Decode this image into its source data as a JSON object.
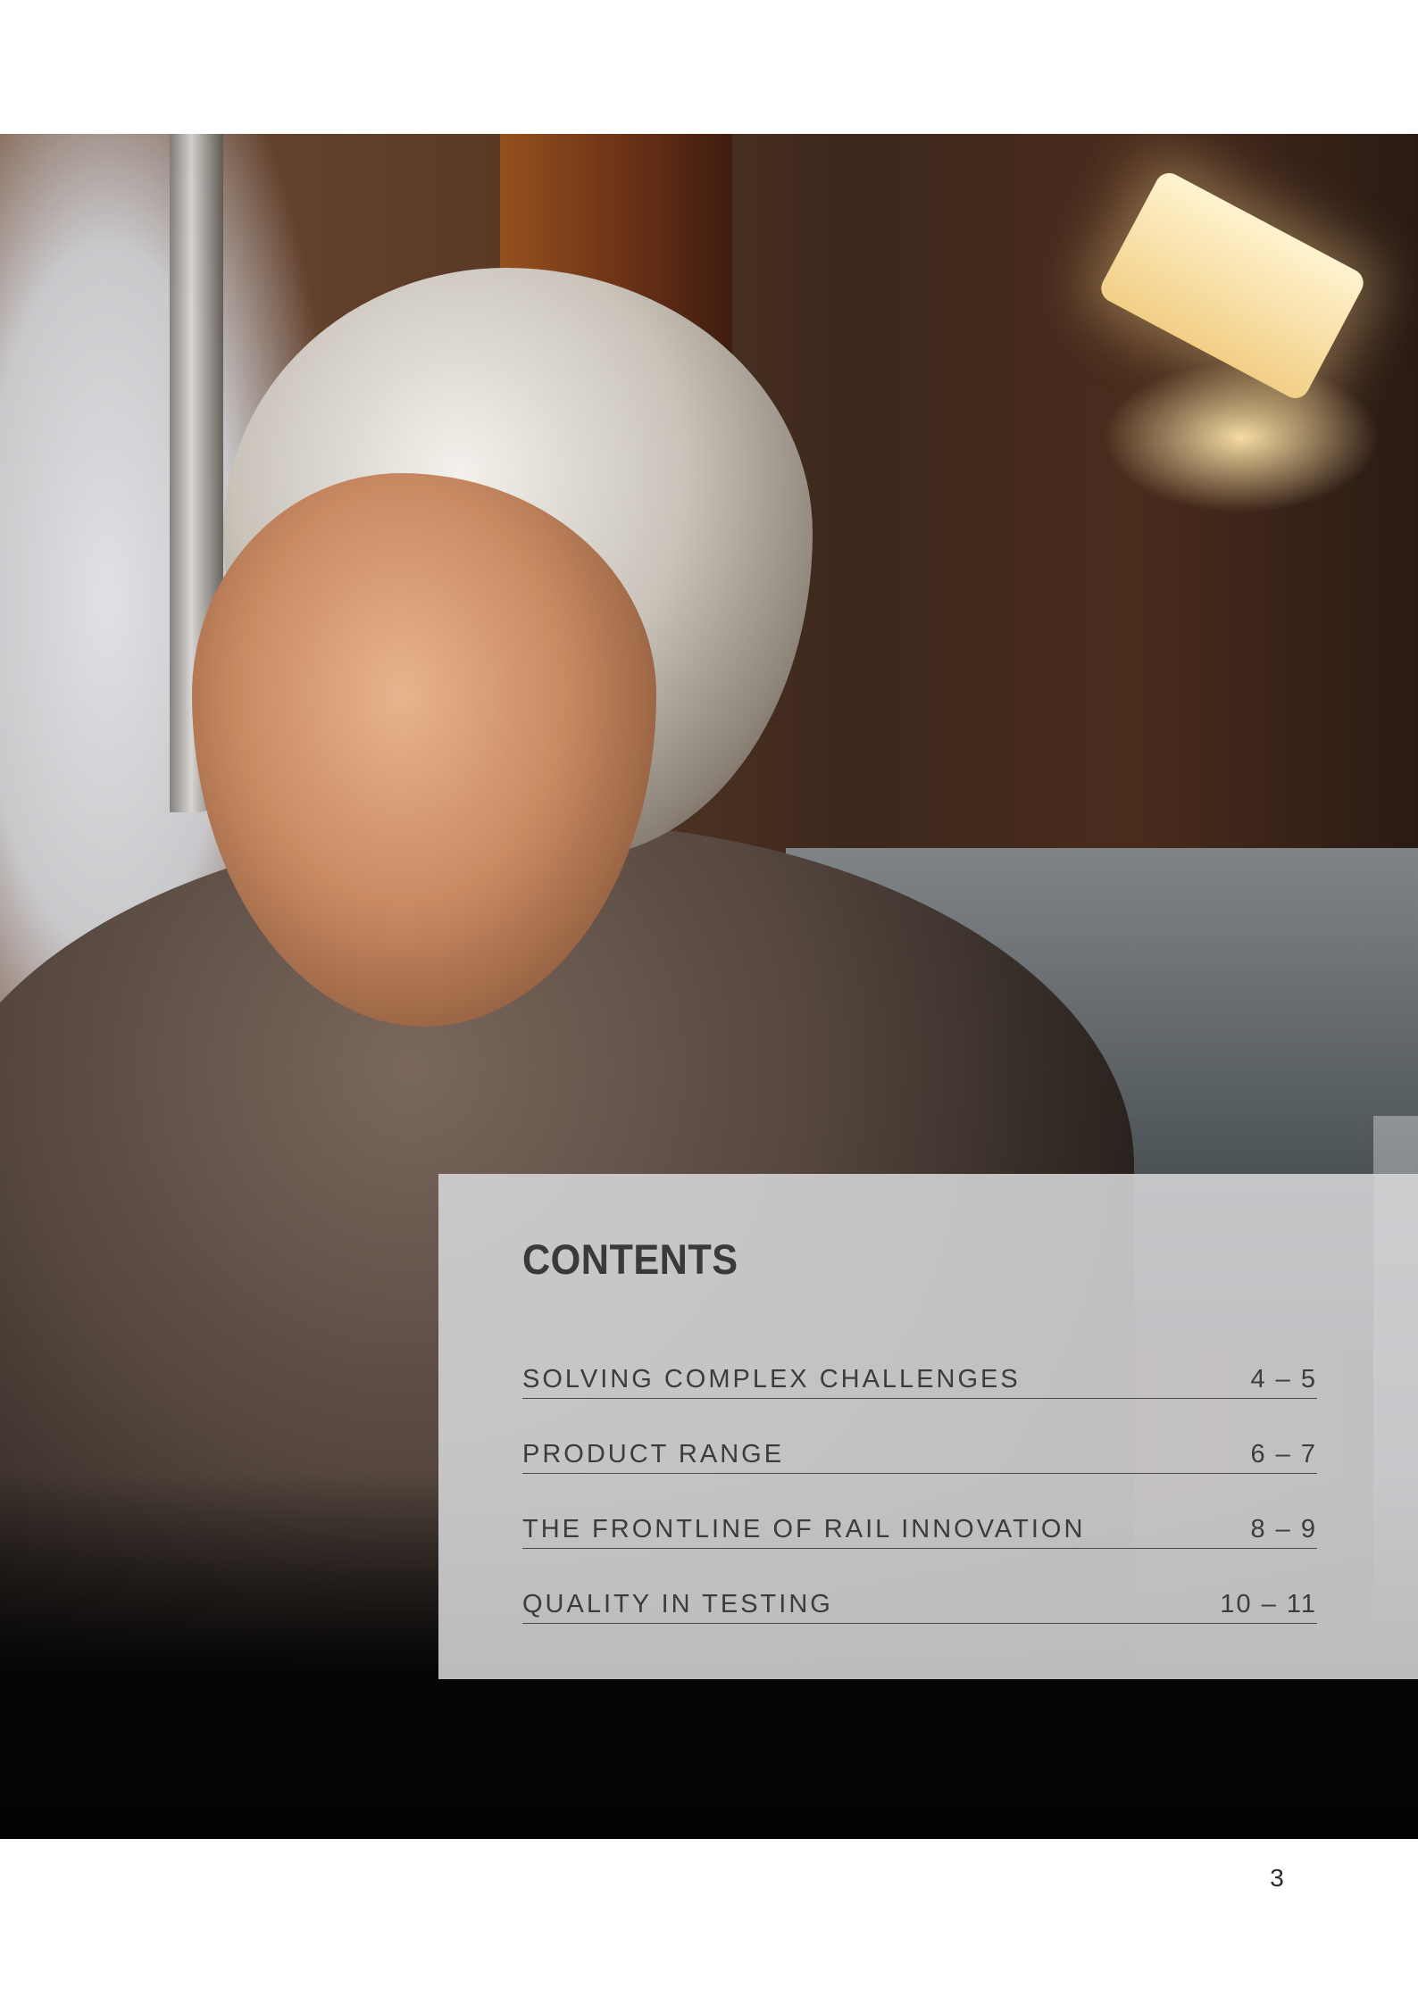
{
  "hero_image": {
    "subject": "woman-looking-out-train-window",
    "colors": {
      "window_light": "#dfe1e4",
      "interior_wood": "#5a3a27",
      "scarf": "#54463e",
      "lamp_glow": "#f2cf86"
    }
  },
  "contents": {
    "title": "CONTENTS",
    "panel_color": "#d6d6d8",
    "items": [
      {
        "label": "SOLVING COMPLEX CHALLENGES",
        "pages": "4 – 5"
      },
      {
        "label": "PRODUCT RANGE",
        "pages": "6 – 7"
      },
      {
        "label": "THE FRONTLINE OF RAIL INNOVATION",
        "pages": "8 – 9"
      },
      {
        "label": "QUALITY IN TESTING",
        "pages": "10 – 11"
      }
    ]
  },
  "footer": {
    "page_number": "3"
  }
}
